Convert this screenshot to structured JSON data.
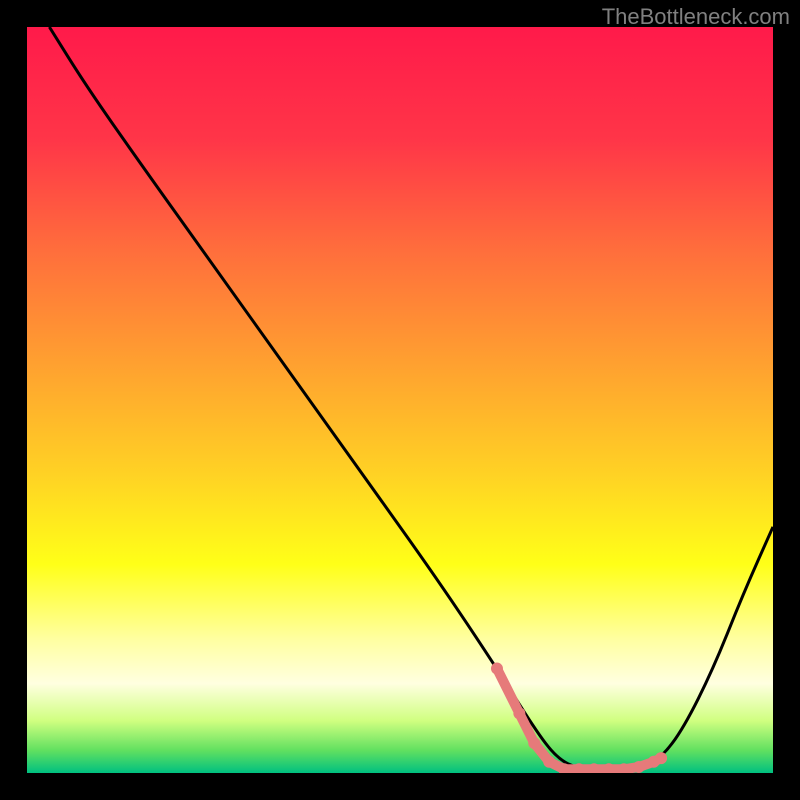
{
  "watermark": "TheBottleneck.com",
  "chart_data": {
    "type": "line",
    "title": "",
    "xlabel": "",
    "ylabel": "",
    "xlim": [
      0,
      100
    ],
    "ylim": [
      0,
      100
    ],
    "gradient_stops": [
      {
        "offset": 0,
        "color": "#FF1A4A"
      },
      {
        "offset": 15,
        "color": "#FF3548"
      },
      {
        "offset": 30,
        "color": "#FF6E3C"
      },
      {
        "offset": 45,
        "color": "#FFA030"
      },
      {
        "offset": 60,
        "color": "#FFD224"
      },
      {
        "offset": 72,
        "color": "#FFFF18"
      },
      {
        "offset": 82,
        "color": "#FFFFA0"
      },
      {
        "offset": 88,
        "color": "#FFFFE0"
      },
      {
        "offset": 93,
        "color": "#D0FF80"
      },
      {
        "offset": 97,
        "color": "#60E060"
      },
      {
        "offset": 100,
        "color": "#00C080"
      }
    ],
    "series": [
      {
        "name": "bottleneck-curve",
        "color": "#000000",
        "x": [
          3,
          8,
          15,
          25,
          35,
          45,
          55,
          63,
          68,
          71,
          74,
          78,
          82,
          85,
          88,
          92,
          96,
          100
        ],
        "y": [
          100,
          92,
          82,
          68,
          54,
          40,
          26,
          14,
          6,
          2,
          0.5,
          0.5,
          0.5,
          2,
          6,
          14,
          24,
          33
        ]
      }
    ],
    "highlight_segment": {
      "color": "#E67A7A",
      "x_start": 63,
      "x_end": 85,
      "points": [
        {
          "x": 63,
          "y": 14
        },
        {
          "x": 66,
          "y": 8
        },
        {
          "x": 68,
          "y": 4
        },
        {
          "x": 70,
          "y": 1.5
        },
        {
          "x": 72,
          "y": 0.5
        },
        {
          "x": 74,
          "y": 0.5
        },
        {
          "x": 76,
          "y": 0.5
        },
        {
          "x": 78,
          "y": 0.5
        },
        {
          "x": 80,
          "y": 0.5
        },
        {
          "x": 82,
          "y": 0.8
        },
        {
          "x": 84,
          "y": 1.5
        },
        {
          "x": 85,
          "y": 2
        }
      ]
    }
  }
}
